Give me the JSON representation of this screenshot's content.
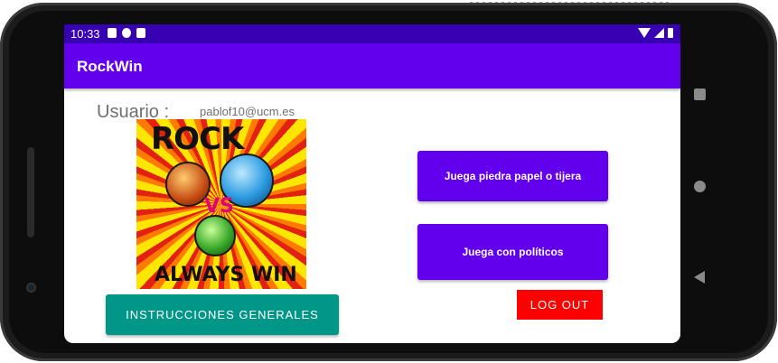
{
  "status_bar": {
    "time": "10:33"
  },
  "app_bar": {
    "title": "RockWin"
  },
  "user": {
    "label": "Usuario :",
    "email": "pablof10@ucm.es"
  },
  "logo": {
    "top_text": "ROCK",
    "middle_text": "VS",
    "bottom_text": "ALWAYS WIN"
  },
  "buttons": {
    "rock_paper_scissors": "Juega piedra papel o tijera",
    "politicians": "Juega con políticos",
    "logout": "LOG OUT",
    "instructions": "INSTRUCCIONES GENERALES"
  },
  "colors": {
    "status_bar": "#3700b3",
    "app_bar": "#6200ee",
    "primary_button": "#6200ee",
    "logout_button": "#ff0000",
    "instructions_button": "#009688"
  }
}
